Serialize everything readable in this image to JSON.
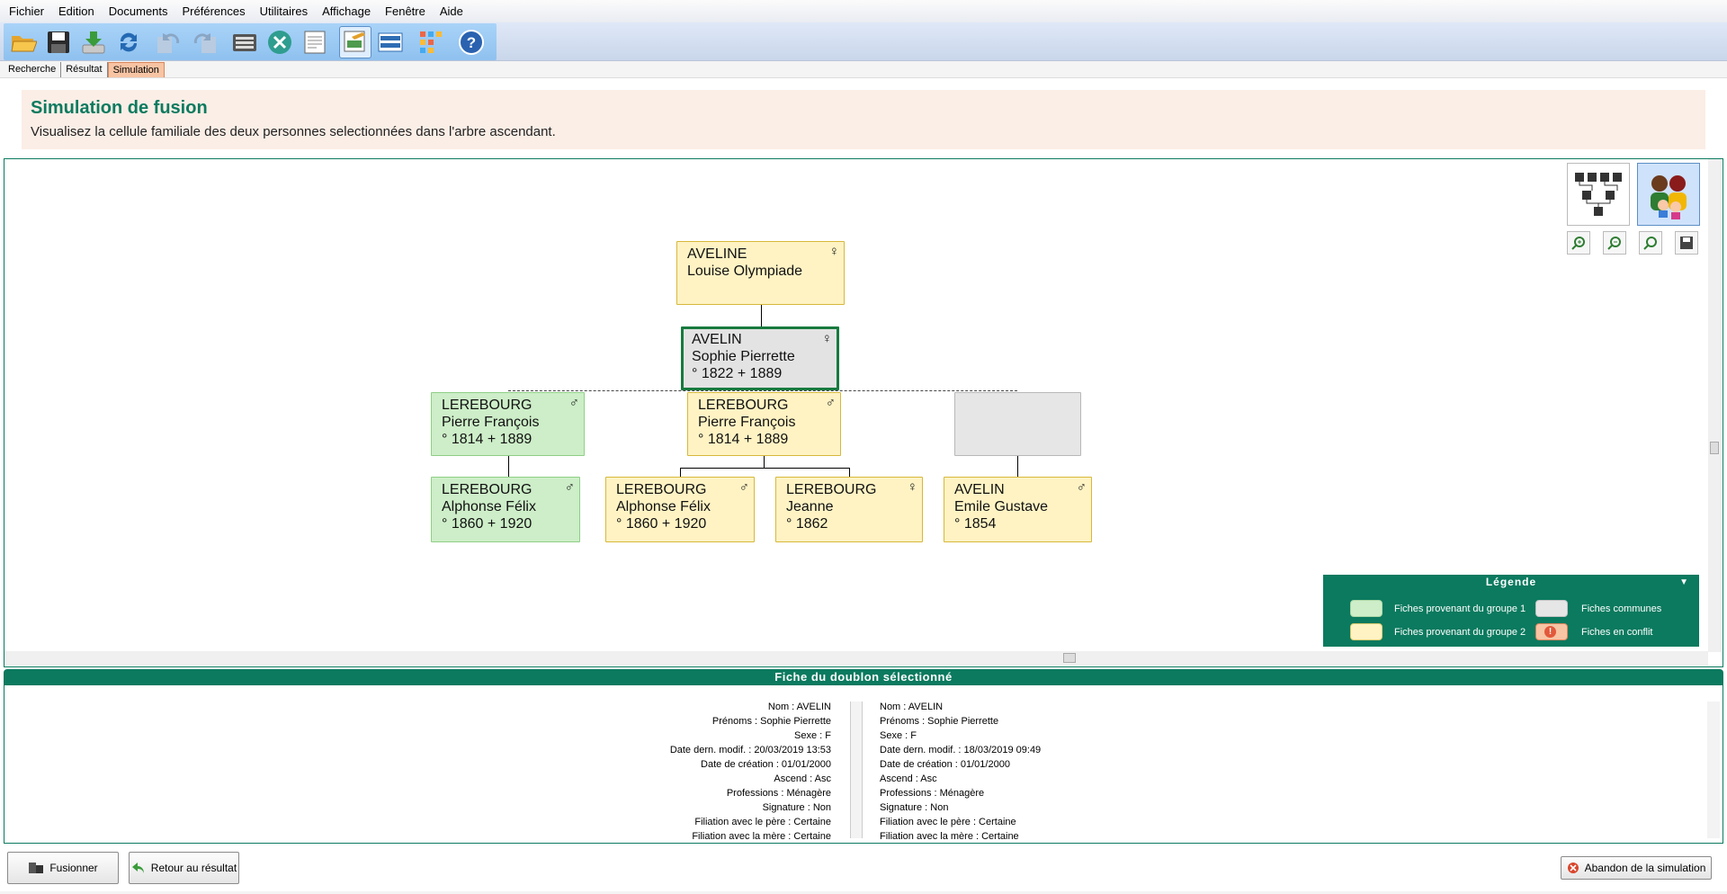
{
  "menu": [
    "Fichier",
    "Edition",
    "Documents",
    "Préférences",
    "Utilitaires",
    "Affichage",
    "Fenêtre",
    "Aide"
  ],
  "toolbar": {
    "icons": [
      "open-folder-icon",
      "save-icon",
      "download-icon",
      "refresh-icon",
      "undo-icon",
      "redo-icon",
      "keyboard-icon",
      "tools-icon",
      "document-icon",
      "edit-document-icon",
      "layout-icon",
      "colors-grid-icon",
      "help-icon"
    ]
  },
  "tabs": [
    "Recherche",
    "Résultat",
    "Simulation"
  ],
  "header": {
    "title": "Simulation de fusion",
    "subtitle": "Visualisez la cellule familiale des deux personnes selectionnées dans l'arbre ascendant."
  },
  "tree": {
    "mother": {
      "surname": "AVELINE",
      "given": "Louise Olympiade",
      "dates": "",
      "sex": "♀"
    },
    "selected": {
      "surname": "AVELIN",
      "given": "Sophie Pierrette",
      "dates": "° 1822  + 1889",
      "sex": "♀"
    },
    "spouse1": {
      "surname": "LEREBOURG",
      "given": "Pierre François",
      "dates": "° 1814  + 1889",
      "sex": "♂"
    },
    "spouse2": {
      "surname": "LEREBOURG",
      "given": "Pierre François",
      "dates": "° 1814  + 1889",
      "sex": "♂"
    },
    "child1": {
      "surname": "LEREBOURG",
      "given": "Alphonse Félix",
      "dates": "° 1860  + 1920",
      "sex": "♂"
    },
    "child2": {
      "surname": "LEREBOURG",
      "given": "Alphonse Félix",
      "dates": "° 1860  + 1920",
      "sex": "♂"
    },
    "child3": {
      "surname": "LEREBOURG",
      "given": "Jeanne",
      "dates": "° 1862",
      "sex": "♀"
    },
    "child4": {
      "surname": "AVELIN",
      "given": "Emile Gustave",
      "dates": "° 1854",
      "sex": "♂"
    }
  },
  "legend": {
    "title": "Légende",
    "group1": "Fiches provenant du groupe 1",
    "group2": "Fiches provenant du groupe 2",
    "common": "Fiches communes",
    "conflict": "Fiches en conflit",
    "colors": {
      "group1": "#cdeec8",
      "group2": "#fff3c4",
      "common": "#e6e6e6",
      "conflict": "#f7c4a4"
    }
  },
  "fiche": {
    "title": "Fiche du doublon sélectionné",
    "left": [
      "Nom : AVELIN",
      "Prénoms : Sophie Pierrette",
      "Sexe : F",
      "Date dern. modif. : 20/03/2019 13:53",
      "Date de création : 01/01/2000",
      "Ascend : Asc",
      "Professions : Ménagère",
      "Signature : Non",
      "Filiation avec le père : Certaine",
      "Filiation avec la mère : Certaine"
    ],
    "right": [
      "Nom : AVELIN",
      "Prénoms : Sophie Pierrette",
      "Sexe : F",
      "Date dern. modif. : 18/03/2019 09:49",
      "Date de création : 01/01/2000",
      "Ascend : Asc",
      "Professions : Ménagère",
      "Signature : Non",
      "Filiation avec le père : Certaine",
      "Filiation avec la mère : Certaine"
    ]
  },
  "buttons": {
    "merge": "Fusionner",
    "back": "Retour au résultat",
    "abort": "Abandon de la simulation"
  }
}
